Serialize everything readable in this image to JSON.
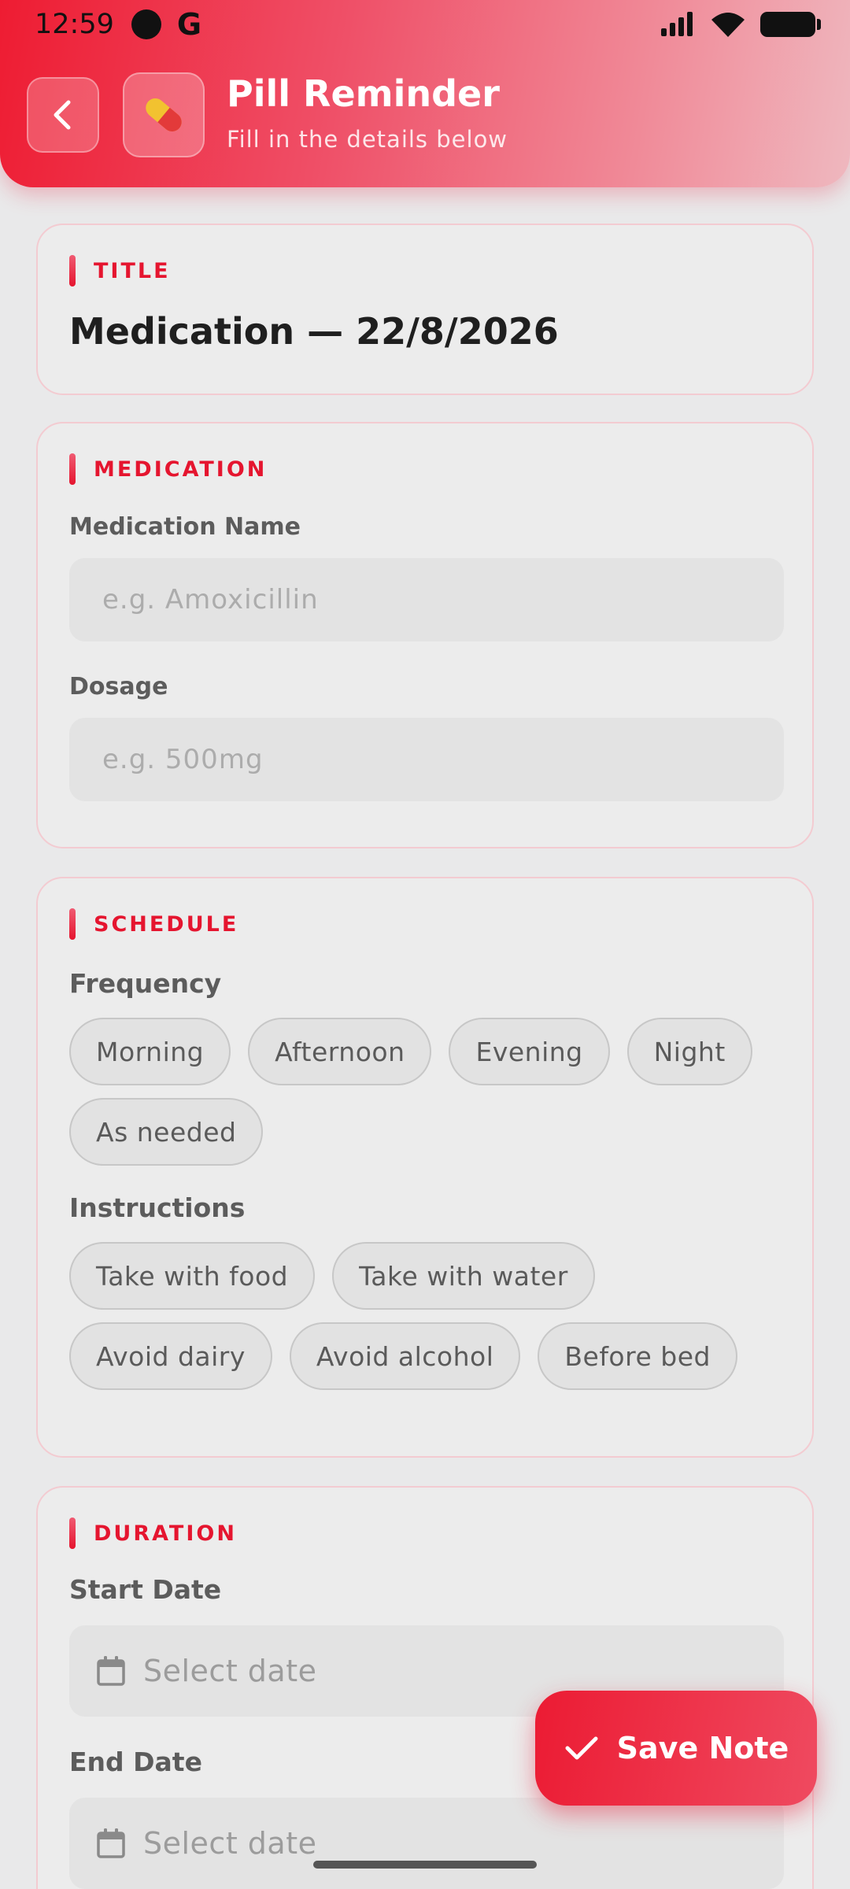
{
  "status_bar": {
    "time": "12:59",
    "carrier_letter": "G"
  },
  "header": {
    "title": "Pill Reminder",
    "subtitle": "Fill in the details below",
    "app_icon": "pill-icon",
    "accent_color": "#ee1c32"
  },
  "title_section": {
    "label": "TITLE",
    "value": "Medication — 22/8/2026"
  },
  "medication_section": {
    "label": "MEDICATION",
    "name_label": "Medication Name",
    "name_placeholder": "e.g. Amoxicillin",
    "dosage_label": "Dosage",
    "dosage_placeholder": "e.g. 500mg"
  },
  "schedule_section": {
    "label": "SCHEDULE",
    "frequency_label": "Frequency",
    "frequency_options": [
      "Morning",
      "Afternoon",
      "Evening",
      "Night",
      "As needed"
    ],
    "instructions_label": "Instructions",
    "instruction_options": [
      "Take with food",
      "Take with water",
      "Avoid dairy",
      "Avoid alcohol",
      "Before bed"
    ]
  },
  "duration_section": {
    "label": "DURATION",
    "start_label": "Start Date",
    "start_placeholder": "Select date",
    "end_label": "End Date",
    "end_placeholder": "Select date"
  },
  "fab": {
    "label": "Save Note"
  }
}
